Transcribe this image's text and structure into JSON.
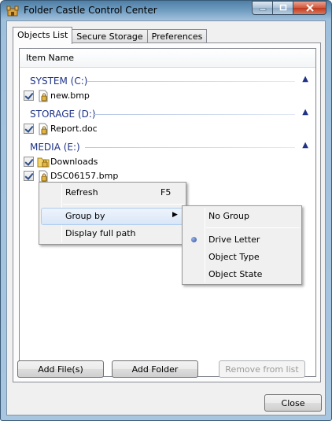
{
  "window": {
    "title": "Folder Castle Control Center"
  },
  "tabs": [
    {
      "label": "Objects List",
      "active": true
    },
    {
      "label": "Secure Storage",
      "active": false
    },
    {
      "label": "Preferences",
      "active": false
    }
  ],
  "list": {
    "column_header": "Item Name",
    "groups": [
      {
        "name": "SYSTEM (C:)",
        "items": [
          {
            "name": "new.bmp",
            "checked": true,
            "icon": "file-lock-icon"
          }
        ]
      },
      {
        "name": "STORAGE (D:)",
        "items": [
          {
            "name": "Report.doc",
            "checked": true,
            "icon": "file-lock-icon"
          }
        ]
      },
      {
        "name": "MEDIA (E:)",
        "items": [
          {
            "name": "Downloads",
            "checked": true,
            "icon": "folder-lock-icon"
          },
          {
            "name": "DSC06157.bmp",
            "checked": true,
            "icon": "file-lock-icon"
          }
        ]
      }
    ]
  },
  "context_menu": {
    "refresh": {
      "label": "Refresh",
      "accelerator": "F5"
    },
    "group_by": {
      "label": "Group by"
    },
    "display_full_path": {
      "label": "Display full path"
    }
  },
  "submenu": {
    "no_group": "No Group",
    "drive_letter": "Drive Letter",
    "object_type": "Object Type",
    "object_state": "Object State",
    "selected": "Drive Letter"
  },
  "buttons": {
    "add_files": "Add File(s)",
    "add_folder": "Add Folder",
    "remove_from_list": "Remove from list",
    "close": "Close"
  },
  "colors": {
    "group_header": "#1e3287",
    "menu_highlight": "#dae6f7"
  }
}
